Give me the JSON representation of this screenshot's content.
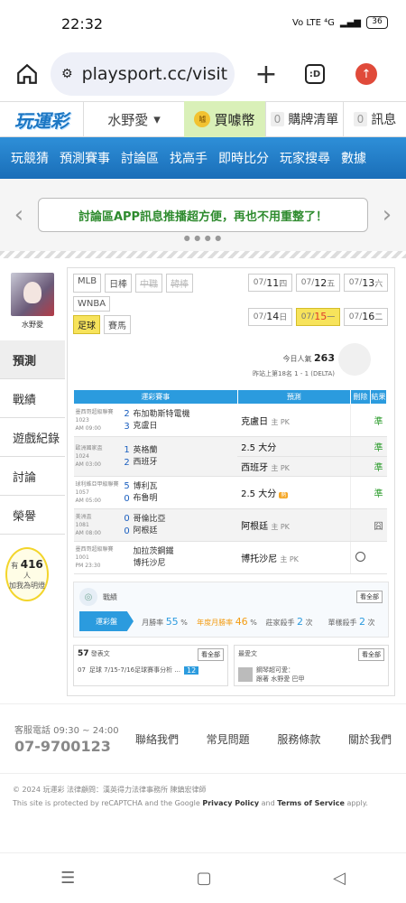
{
  "status": {
    "time": "22:32",
    "net": "Vo LTE ⁴G",
    "battery": "36"
  },
  "browser": {
    "url": "playsport.cc/visit"
  },
  "header": {
    "logo": "玩運彩",
    "username": "水野愛",
    "buy_label": "買噱幣",
    "cart_count": "0",
    "cart_label": "購牌清單",
    "msg_count": "0",
    "msg_label": "訊息"
  },
  "nav": [
    "玩競猜",
    "預測賽事",
    "討論區",
    "找高手",
    "即時比分",
    "玩家搜尋",
    "數據"
  ],
  "banner": {
    "text": "討論區APP訊息推播超方便，再也不用重整了！"
  },
  "sidebar": {
    "avatar_name": "水野愛",
    "tabs": [
      "預測",
      "戰績",
      "遊戲紀錄",
      "討論",
      "榮譽"
    ],
    "rate_prefix": "有",
    "rate_count": "416",
    "rate_unit": "人",
    "rate_text": "加我為明燈"
  },
  "leagues": [
    [
      "MLB",
      "日棒",
      "中職",
      "韓棒"
    ],
    [
      "WNBA"
    ],
    [
      "足球",
      "賽馬"
    ]
  ],
  "dates": [
    {
      "d": "07/",
      "n": "11",
      "w": "四"
    },
    {
      "d": "07/",
      "n": "12",
      "w": "五"
    },
    {
      "d": "07/",
      "n": "13",
      "w": "六"
    },
    {
      "d": "07/",
      "n": "14",
      "w": "日"
    },
    {
      "d": "07/",
      "n": "15",
      "w": "一"
    },
    {
      "d": "07/",
      "n": "16",
      "w": "二"
    }
  ],
  "popularity": {
    "label": "今日人氣",
    "value": "263",
    "rank": "昨站上第18名 1 - 1 (DELTA)"
  },
  "table": {
    "headers": [
      "運彩賽事",
      "預測",
      "刪除",
      "結果"
    ],
    "rows": [
      {
        "league": "墨西哥超級聯賽",
        "id": "1023",
        "time": "AM 09:00",
        "s1": "2",
        "s2": "3",
        "t1": "布加勒斯特電機",
        "t2": "克盧日",
        "pred": "克盧日",
        "pk": "主 PK",
        "res": "準"
      },
      {
        "league": "歐洲國家盃",
        "id": "1024",
        "time": "AM 03:00",
        "s1": "1",
        "s2": "2",
        "t1": "英格蘭",
        "t2": "西班牙",
        "pred": "2.5 大分",
        "pred2": "西班牙",
        "pk2": "主 PK",
        "res": "準",
        "res2": "準"
      },
      {
        "league": "球利維亞甲級聯賽",
        "id": "1057",
        "time": "AM 05:00",
        "s1": "5",
        "s2": "0",
        "t1": "博利瓦",
        "t2": "布魯明",
        "pred": "2.5 大分",
        "res": "準"
      },
      {
        "league": "美洲盃",
        "id": "1081",
        "time": "AM 08:00",
        "s1": "0",
        "s2": "0",
        "t1": "哥倫比亞",
        "t2": "阿根廷",
        "pred": "阿根廷",
        "pk": "主 PK",
        "res": "囧"
      },
      {
        "league": "墨西哥超級聯賽",
        "id": "1001",
        "time": "PM 23:30",
        "s1": "",
        "s2": "",
        "t1": "加拉茨鋼鐵",
        "t2": "博托沙尼",
        "pred": "博托沙尼",
        "pk": "主 PK",
        "res": ""
      }
    ]
  },
  "record": {
    "title": "戰績",
    "more": "看全部",
    "hd": "運彩盤",
    "stats": [
      {
        "label": "月勝率",
        "value": "55",
        "unit": "%"
      },
      {
        "label": "年度月勝率",
        "value": "46",
        "unit": "%"
      },
      {
        "label": "莊家殺手",
        "value": "2",
        "unit": "次"
      },
      {
        "label": "單樣殺手",
        "value": "2",
        "unit": "次"
      }
    ]
  },
  "posts": {
    "count": "57",
    "label": "發表文",
    "more": "看全部",
    "date": "07",
    "sub": "足球 7/15-7/16足球賽事分析 ...",
    "tag": "12"
  },
  "favs": {
    "label": "最愛文",
    "more": "看全部",
    "sub": "鋼琴超可愛：",
    "sub2": "跟著 水野愛 巴甲"
  },
  "footer": {
    "hotline_label": "客服電話 09:30 ~ 24:00",
    "hotline": "07-9700123",
    "links": [
      "聯絡我們",
      "常見問題",
      "服務條款",
      "關於我們"
    ],
    "copyright": "© 2024 玩運彩 法律顧問：漢英得力法律事務所 陳鎮宏律師",
    "recaptcha": "This site is protected by reCAPTCHA and the Google",
    "pp": "Privacy Policy",
    "and": "and",
    "tos": "Terms of Service",
    "apply": "apply."
  }
}
